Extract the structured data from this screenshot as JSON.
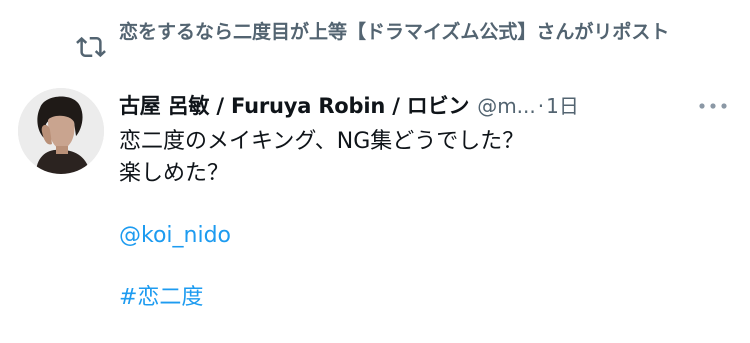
{
  "repost": {
    "text": "恋をするなら二度目が上等【ドラマイズム公式】さんがリポスト",
    "icon": "repost-icon"
  },
  "author": {
    "display_name": "古屋 呂敏 / Furuya Robin / ロビン",
    "handle": "@m...",
    "separator": "·",
    "time": "1日",
    "avatar": "avatar"
  },
  "tweet": {
    "line1": "恋二度のメイキング、NG集どうでした？",
    "line2": "楽しめた？",
    "mention": "@koi_nido",
    "hashtag": "#恋二度"
  },
  "icons": {
    "more": "more-horizontal-icon"
  },
  "colors": {
    "text": "#0f1419",
    "secondary": "#536471",
    "link": "#1d9bf0"
  }
}
